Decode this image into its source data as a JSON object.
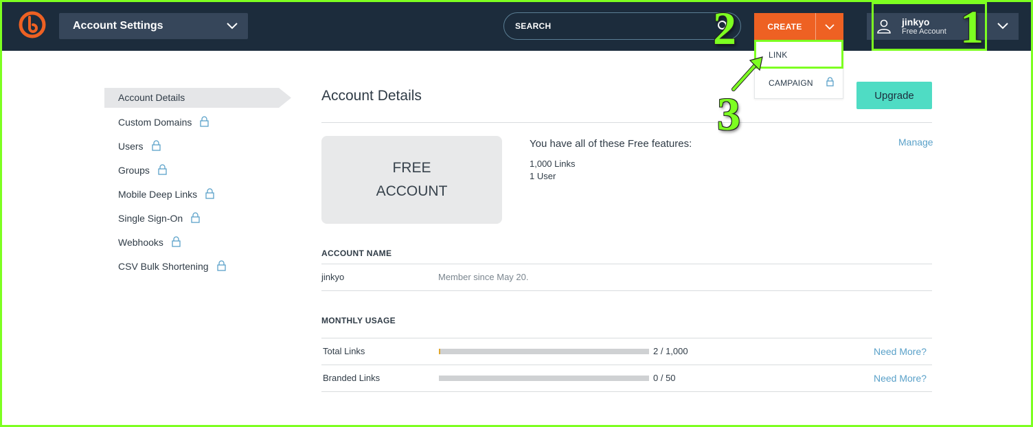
{
  "header": {
    "context_label": "Account Settings",
    "search_placeholder": "SEARCH",
    "create_label": "CREATE",
    "create_menu": [
      {
        "label": "LINK",
        "locked": false
      },
      {
        "label": "CAMPAIGN",
        "locked": true
      }
    ],
    "user": {
      "name": "jinkyo",
      "plan": "Free Account"
    }
  },
  "annotations": [
    "1",
    "2",
    "3"
  ],
  "sidebar": {
    "items": [
      {
        "label": "Account Details",
        "locked": false,
        "active": true
      },
      {
        "label": "Custom Domains",
        "locked": true
      },
      {
        "label": "Users",
        "locked": true
      },
      {
        "label": "Groups",
        "locked": true
      },
      {
        "label": "Mobile Deep Links",
        "locked": true
      },
      {
        "label": "Single Sign-On",
        "locked": true
      },
      {
        "label": "Webhooks",
        "locked": true
      },
      {
        "label": "CSV Bulk Shortening",
        "locked": true
      }
    ]
  },
  "main": {
    "title": "Account Details",
    "upgrade_label": "Upgrade",
    "plan_box": [
      "FREE",
      "ACCOUNT"
    ],
    "features_title": "You have all of these Free features:",
    "features": [
      "1,000 Links",
      "1 User"
    ],
    "manage_label": "Manage",
    "account_name": {
      "heading": "ACCOUNT NAME",
      "name": "jinkyo",
      "member_since": "Member since May 20."
    },
    "usage": {
      "heading": "MONTHLY USAGE",
      "rows": [
        {
          "label": "Total Links",
          "count": "2 / 1,000",
          "fraction": 0.002,
          "action": "Need More?"
        },
        {
          "label": "Branded Links",
          "count": "0 / 50",
          "fraction": 0,
          "action": "Need More?"
        }
      ]
    }
  },
  "colors": {
    "topbar": "#1c2c3c",
    "accent_orange": "#ee6123",
    "upgrade_teal": "#4fdcc4",
    "link_blue": "#5aa1c9",
    "annotation_green": "#7dff21"
  }
}
